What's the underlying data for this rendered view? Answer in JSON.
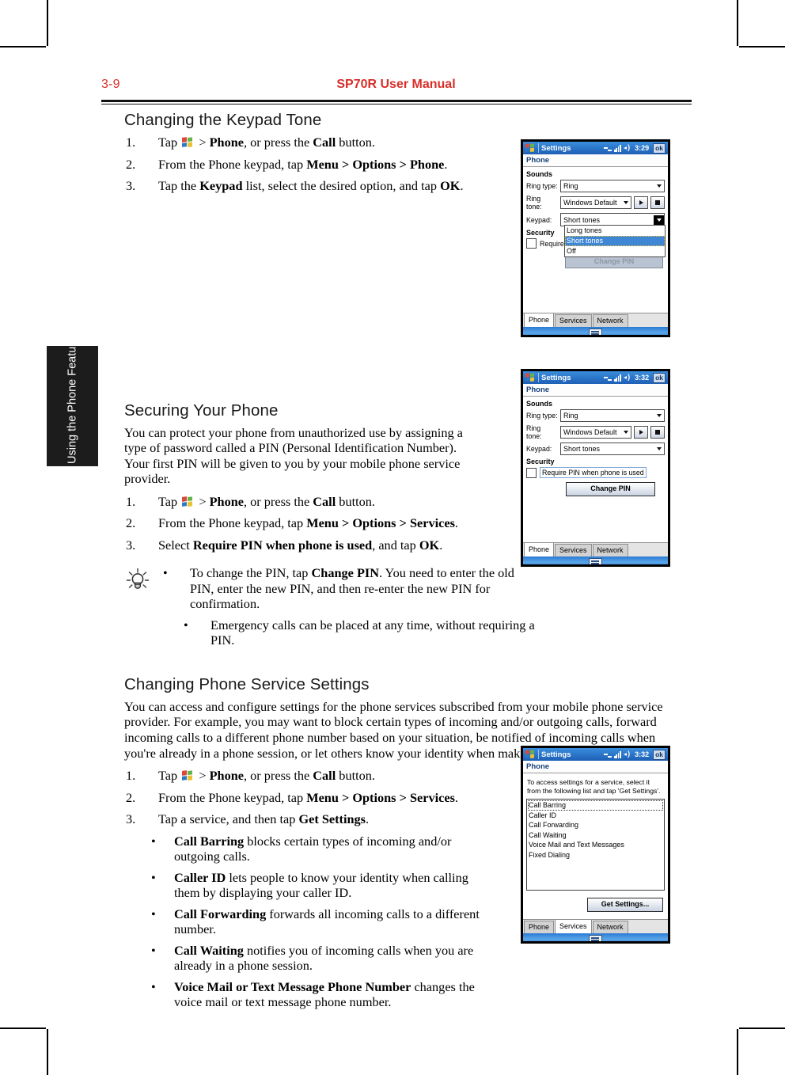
{
  "header": {
    "page_number": "3-9",
    "manual_title": "SP70R User Manual",
    "accent_color": "#d82f2a"
  },
  "side_tab": {
    "label": "Using the Phone Feature"
  },
  "sections": [
    {
      "title": "Changing the Keypad Tone",
      "steps": [
        {
          "num": "1.",
          "pre": "Tap ",
          "icon": "windows-start-icon",
          "post_html": " > <b>Phone</b>, or press the <b>Call</b> button."
        },
        {
          "num": "2.",
          "html": "From the Phone keypad, tap <b>Menu &gt; Options &gt; Phone</b>."
        },
        {
          "num": "3.",
          "html": "Tap the <b>Keypad</b> list, select the desired option, and tap <b>OK</b>."
        }
      ]
    },
    {
      "title": "Securing Your Phone",
      "body": "You can protect your phone from unauthorized use by assigning a type of password called a PIN (Personal Identification Number). Your first PIN will be given to you by your mobile phone service provider.",
      "steps": [
        {
          "num": "1.",
          "pre": "Tap ",
          "icon": "windows-start-icon",
          "post_html": " > <b>Phone</b>, or press the <b>Call</b> button."
        },
        {
          "num": "2.",
          "html": "From the Phone keypad, tap <b>Menu &gt; Options &gt; Services</b>."
        },
        {
          "num": "3.",
          "html": "Select <b>Require PIN when phone is used</b>, and tap <b>OK</b>."
        }
      ],
      "tips": [
        "To change the PIN, tap <b>Change PIN</b>. You need to enter the old PIN, enter the new PIN, and then re-enter the new PIN for confirmation.",
        "Emergency calls can be placed at any time, without requiring a PIN."
      ]
    },
    {
      "title": "Changing Phone Service Settings",
      "body": "You can access and configure settings for the phone services subscribed from your mobile phone service provider. For example, you may want to block certain types of incoming and/or outgoing calls, forward incoming calls to a different phone number based on your situation, be notified of incoming calls when you're already in a phone session, or let others know your identity when making calls.",
      "steps": [
        {
          "num": "1.",
          "pre": "Tap ",
          "icon": "windows-start-icon",
          "post_html": " > <b>Phone</b>, or press the <b>Call</b> button."
        },
        {
          "num": "2.",
          "html": "From the Phone keypad, tap <b>Menu &gt; Options &gt; Services</b>."
        },
        {
          "num": "3.",
          "html": "Tap a service, and then tap <b>Get Settings</b>."
        }
      ],
      "services": [
        "<b>Call Barring</b>  blocks certain types of incoming and/or outgoing calls.",
        "<b>Caller ID</b>  lets people to know your identity when calling them by displaying your caller ID.",
        "<b>Call Forwarding</b>  forwards all incoming calls to a different number.",
        "<b>Call Waiting</b>  notifies you of incoming calls when you are already in a phone session.",
        "<b>Voice Mail or Text Message Phone Number</b>  changes the voice mail or text message phone number."
      ]
    }
  ],
  "screenshots": [
    {
      "id": "keypad-tone-screenshot",
      "titlebar": {
        "app": "Settings",
        "time": "3:29",
        "ok": "ok"
      },
      "subbar": "Phone",
      "group_sounds": "Sounds",
      "rows": [
        {
          "label": "Ring type:",
          "value": "Ring"
        },
        {
          "label": "Ring tone:",
          "value": "Windows Default"
        },
        {
          "label": "Keypad:",
          "value": "Short tones"
        }
      ],
      "group_security": "Security",
      "checkbox_label": "Require",
      "dropdown_options": [
        "Long tones",
        "Short tones",
        "Off"
      ],
      "dropdown_selected": "Short tones",
      "obscured_button": "Change PIN",
      "tabs": [
        "Phone",
        "Services",
        "Network"
      ],
      "active_tab": "Phone"
    },
    {
      "id": "securing-phone-screenshot",
      "titlebar": {
        "app": "Settings",
        "time": "3:32",
        "ok": "ok"
      },
      "subbar": "Phone",
      "group_sounds": "Sounds",
      "rows": [
        {
          "label": "Ring type:",
          "value": "Ring"
        },
        {
          "label": "Ring tone:",
          "value": "Windows Default"
        },
        {
          "label": "Keypad:",
          "value": "Short tones"
        }
      ],
      "group_security": "Security",
      "checkbox_label": "Require PIN when phone is used",
      "change_pin_button": "Change PIN",
      "tabs": [
        "Phone",
        "Services",
        "Network"
      ],
      "active_tab": "Phone"
    },
    {
      "id": "phone-services-screenshot",
      "titlebar": {
        "app": "Settings",
        "time": "3:32",
        "ok": "ok"
      },
      "subbar": "Phone",
      "instruction": "To access settings for a service, select it from the following list and tap 'Get Settings'.",
      "service_list": [
        "Call Barring",
        "Caller ID",
        "Call Forwarding",
        "Call Waiting",
        "Voice Mail and Text Messages",
        "Fixed Dialing"
      ],
      "focused_item": "Call Barring",
      "get_settings_button": "Get Settings...",
      "tabs": [
        "Phone",
        "Services",
        "Network"
      ],
      "active_tab": "Services"
    }
  ]
}
